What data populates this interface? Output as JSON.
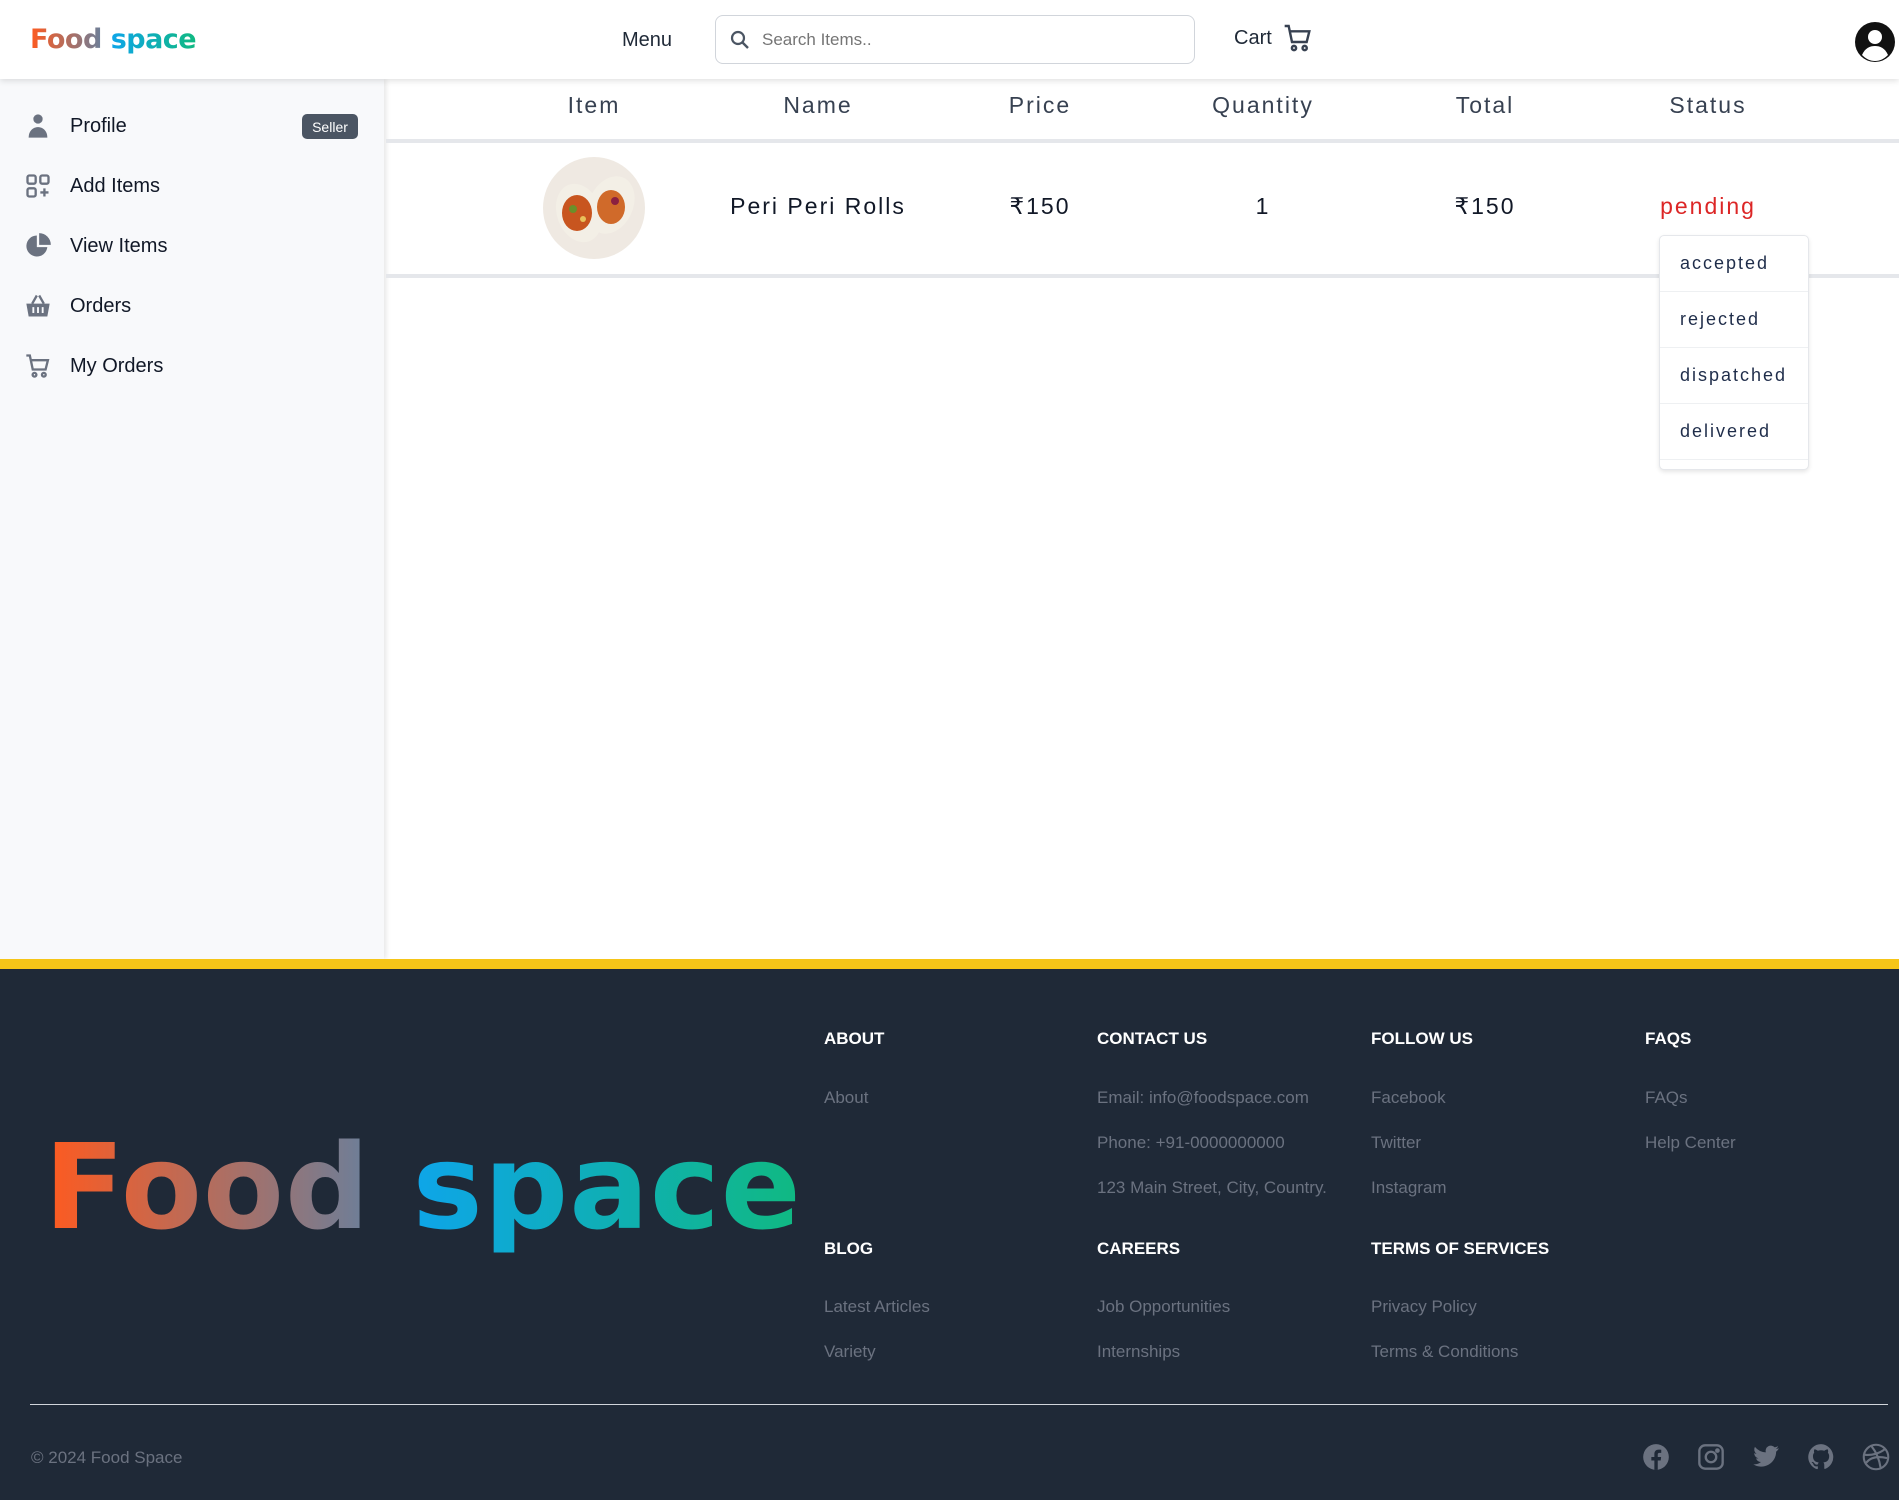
{
  "header": {
    "logo_part1": "Food",
    "logo_part2": "space",
    "menu_label": "Menu",
    "search_placeholder": "Search Items..",
    "cart_label": "Cart"
  },
  "sidebar": {
    "badge": "Seller",
    "items": [
      {
        "label": "Profile",
        "icon": "user-icon"
      },
      {
        "label": "Add Items",
        "icon": "grid-plus-icon"
      },
      {
        "label": "View Items",
        "icon": "pie-chart-icon"
      },
      {
        "label": "Orders",
        "icon": "basket-icon"
      },
      {
        "label": "My Orders",
        "icon": "cart-icon"
      }
    ]
  },
  "table": {
    "headers": [
      "Item",
      "Name",
      "Price",
      "Quantity",
      "Total",
      "Status"
    ],
    "rows": [
      {
        "name": "Peri Peri Rolls",
        "price": "₹150",
        "quantity": "1",
        "total": "₹150",
        "status": "pending"
      }
    ]
  },
  "status_dropdown": {
    "options": [
      "accepted",
      "rejected",
      "dispatched",
      "delivered"
    ]
  },
  "colors": {
    "pending": "#dc2626",
    "footer_bg": "#1f2937",
    "footer_accent": "#f5c518"
  },
  "footer": {
    "logo_part1": "Food",
    "logo_part2": "space",
    "sections": [
      {
        "title": "ABOUT",
        "links": [
          "About"
        ]
      },
      {
        "title": "CONTACT US",
        "links": [
          "Email: info@foodspace.com",
          "Phone: +91-0000000000",
          "123 Main Street, City, Country."
        ]
      },
      {
        "title": "FOLLOW US",
        "links": [
          "Facebook",
          "Twitter",
          "Instagram"
        ]
      },
      {
        "title": "FAQS",
        "links": [
          "FAQs",
          "Help Center"
        ]
      },
      {
        "title": "BLOG",
        "links": [
          "Latest Articles",
          "Variety"
        ]
      },
      {
        "title": "CAREERS",
        "links": [
          "Job Opportunities",
          "Internships"
        ]
      },
      {
        "title": "TERMS OF SERVICES",
        "links": [
          "Privacy Policy",
          "Terms & Conditions"
        ]
      }
    ],
    "copyright": "© 2024 Food Space",
    "social": [
      "facebook-icon",
      "instagram-icon",
      "twitter-icon",
      "github-icon",
      "dribbble-icon"
    ]
  }
}
